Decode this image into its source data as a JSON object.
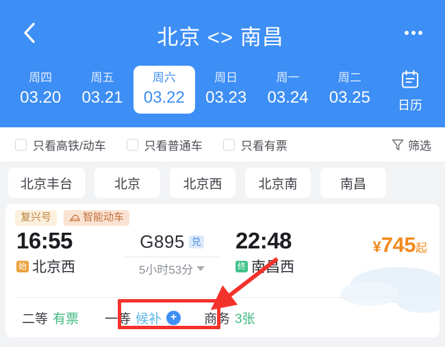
{
  "header": {
    "title": "北京 <> 南昌",
    "back_icon": "chevron-left-icon",
    "more_icon": "more-horizontal-icon",
    "accent_color": "#3d8ef5"
  },
  "dates": {
    "items": [
      {
        "dow": "周四",
        "date": "03.20",
        "active": false
      },
      {
        "dow": "周五",
        "date": "03.21",
        "active": false
      },
      {
        "dow": "周六",
        "date": "03.22",
        "active": true
      },
      {
        "dow": "周日",
        "date": "03.23",
        "active": false
      },
      {
        "dow": "周一",
        "date": "03.24",
        "active": false
      },
      {
        "dow": "周二",
        "date": "03.25",
        "active": false
      }
    ],
    "calendar": {
      "icon": "calendar-icon",
      "label": "日历"
    }
  },
  "filters": {
    "checkboxes": [
      {
        "label": "只看高铁/动车",
        "checked": false
      },
      {
        "label": "只看普通车",
        "checked": false
      },
      {
        "label": "只看有票",
        "checked": false
      }
    ],
    "filter_button": {
      "icon": "funnel-icon",
      "label": "筛选"
    }
  },
  "stations": {
    "chips": [
      "北京丰台",
      "北京",
      "北京西",
      "北京南",
      "南昌"
    ]
  },
  "train": {
    "tags": [
      {
        "label": "复兴号",
        "type": "fuxing"
      },
      {
        "label": "智能动车",
        "type": "smart",
        "icon": "train-icon"
      }
    ],
    "depart_time": "16:55",
    "depart_station": "北京西",
    "depart_badge": "始",
    "depart_badge_color": "#eda13c",
    "arrive_time": "22:48",
    "arrive_station": "南昌西",
    "arrive_badge": "终",
    "arrive_badge_color": "#3fc28a",
    "train_no": "G895",
    "exchange_badge": "兑",
    "duration": "5小时53分",
    "price_symbol": "¥",
    "price_amount": "745",
    "price_suffix": "起",
    "price_color": "#f08a1c",
    "seats": [
      {
        "name": "二等",
        "status": "有票",
        "has_plus": false,
        "status_type": "available"
      },
      {
        "name": "一等",
        "status": "候补",
        "has_plus": true,
        "status_type": "waitlist",
        "plus_label": "+",
        "highlighted": true
      },
      {
        "name": "商务",
        "status": "3张",
        "has_plus": false,
        "status_type": "available"
      }
    ]
  },
  "annotations": {
    "highlight_color": "#f4322c",
    "arrow_color": "#f4322c"
  }
}
